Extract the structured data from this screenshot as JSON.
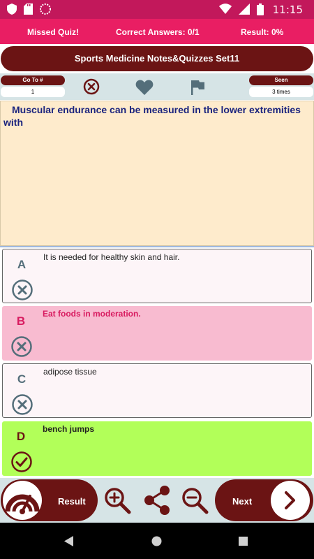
{
  "status_bar": {
    "time": "11:15",
    "left_icons": [
      "shield-icon",
      "sd-card-icon",
      "sync-icon"
    ],
    "right_icons": [
      "wifi-icon",
      "signal-icon",
      "battery-icon"
    ]
  },
  "score_bar": {
    "missed": "Missed Quiz!",
    "correct": "Correct Answers: 0/1",
    "result": "Result: 0%"
  },
  "title": "Sports Medicine Notes&Quizzes Set11",
  "toolbar": {
    "goto_label": "Go To #",
    "goto_value": "1",
    "seen_label": "Seen",
    "seen_value": "3 times",
    "icons": [
      "cancel-icon",
      "heart-icon",
      "flag-icon"
    ]
  },
  "question": "Muscular endurance can be measured in the lower extremities with",
  "options": [
    {
      "letter": "A",
      "text": "It is needed for healthy skin and hair.",
      "state": "neutral"
    },
    {
      "letter": "B",
      "text": "Eat foods in moderation.",
      "state": "wrong"
    },
    {
      "letter": "C",
      "text": "adipose tissue",
      "state": "neutral"
    },
    {
      "letter": "D",
      "text": "bench jumps",
      "state": "correct"
    }
  ],
  "bottom": {
    "result_label": "Result",
    "next_label": "Next",
    "icons": [
      "gauge-icon",
      "zoom-in-icon",
      "share-icon",
      "zoom-out-icon",
      "chevron-right-icon"
    ]
  },
  "colors": {
    "status_bar": "#c2185b",
    "score_bar": "#e91e63",
    "maroon": "#6b1414",
    "question_bg": "#feebcc",
    "question_text": "#1a237e",
    "wrong_bg": "#f8bbd0",
    "wrong_text": "#d81b60",
    "correct_bg": "#b2ff59",
    "icon_slate": "#546e7a"
  }
}
